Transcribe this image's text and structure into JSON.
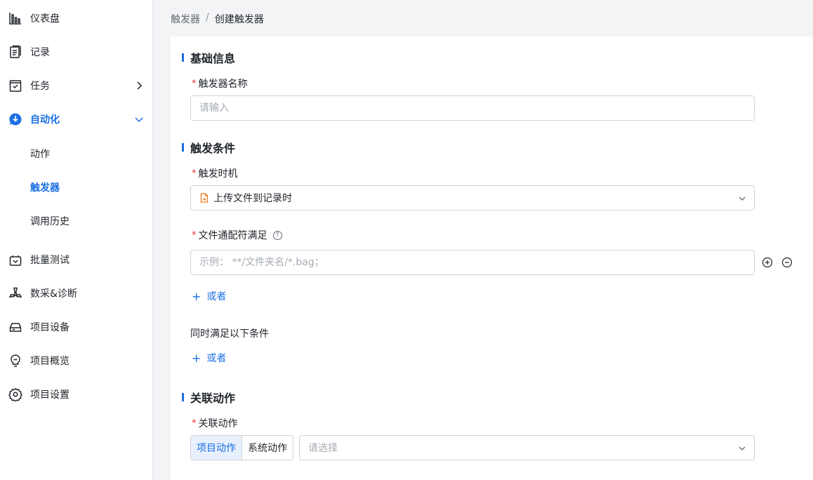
{
  "sidebar": {
    "items": [
      {
        "label": "仪表盘",
        "icon": "chart-bar-icon"
      },
      {
        "label": "记录",
        "icon": "clipboard-icon"
      },
      {
        "label": "任务",
        "icon": "task-icon"
      },
      {
        "label": "自动化",
        "icon": "automation-icon"
      },
      {
        "label": "批量测试",
        "icon": "batch-test-icon"
      },
      {
        "label": "数采&诊断",
        "icon": "radiation-icon"
      },
      {
        "label": "项目设备",
        "icon": "device-icon"
      },
      {
        "label": "项目概览",
        "icon": "bulb-icon"
      },
      {
        "label": "项目设置",
        "icon": "gear-icon"
      }
    ],
    "sub_items": [
      {
        "label": "动作"
      },
      {
        "label": "触发器"
      },
      {
        "label": "调用历史"
      }
    ]
  },
  "breadcrumb": {
    "parent": "触发器",
    "sep": "/",
    "current": "创建触发器"
  },
  "sections": {
    "basic": "基础信息",
    "condition": "触发条件",
    "action": "关联动作"
  },
  "fields": {
    "name_label": "触发器名称",
    "name_placeholder": "请输入",
    "timing_label": "触发时机",
    "timing_value": "上传文件到记录时",
    "wildcard_label": "文件通配符满足",
    "wildcard_placeholder": "示例： **/文件夹名/*.bag；",
    "or_label": "或者",
    "also_label": "同时满足以下条件",
    "action_label": "关联动作",
    "seg_project": "项目动作",
    "seg_system": "系统动作",
    "action_placeholder": "请选择",
    "required_mark": "*",
    "help_mark": "?"
  },
  "colors": {
    "accent": "#1b6fe3",
    "required": "#e5352b",
    "upload_icon": "#f07a22"
  }
}
